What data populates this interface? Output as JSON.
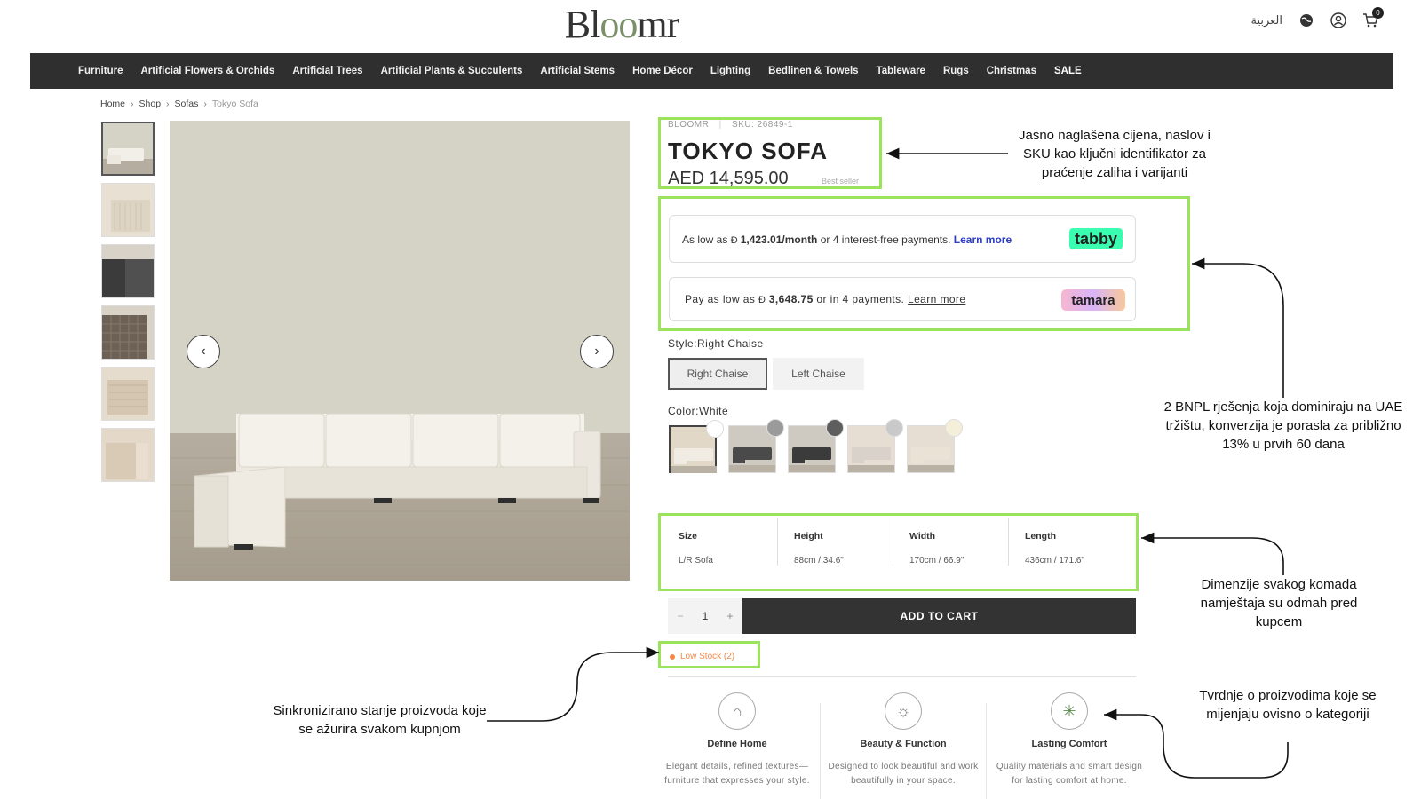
{
  "header": {
    "logo_text_pre": "Bl",
    "logo_text_o": "oo",
    "logo_text_post": "mr",
    "language_label": "العربية",
    "cart_count": "0"
  },
  "nav": {
    "items": [
      "Furniture",
      "Artificial Flowers & Orchids",
      "Artificial Trees",
      "Artificial Plants & Succulents",
      "Artificial Stems",
      "Home Décor",
      "Lighting",
      "Bedlinen & Towels",
      "Tableware",
      "Rugs",
      "Christmas",
      "SALE"
    ]
  },
  "breadcrumb": {
    "items": [
      "Home",
      "Shop",
      "Sofas"
    ],
    "current": "Tokyo Sofa",
    "separator": "›"
  },
  "product": {
    "brand": "BLOOMR",
    "sku": "SKU: 26849-1",
    "title": "TOKYO SOFA",
    "price": "AED 14,595.00",
    "badge": "Best seller"
  },
  "bnpl": {
    "tabby": {
      "text_pre": "As low as ",
      "amount": "1,423.01/month",
      "text_mid": " or 4 interest-free payments. ",
      "link": "Learn more",
      "logo": "tabby"
    },
    "tamara": {
      "text_pre": "Pay as low as ",
      "amount": "3,648.75",
      "text_mid": " or in 4 payments. ",
      "link": "Learn more",
      "logo": "tamara"
    }
  },
  "style_option": {
    "label": "Style:",
    "selected": "Right Chaise",
    "options": [
      "Right Chaise",
      "Left Chaise"
    ]
  },
  "color_option": {
    "label": "Color:",
    "selected": "White",
    "swatches": [
      {
        "name": "white",
        "dot": "#ffffff",
        "bg": "#e2d8c7"
      },
      {
        "name": "dark-grey",
        "dot": "#9a9a9a",
        "bg": "#cfcac1"
      },
      {
        "name": "charcoal",
        "dot": "#5e5e5e",
        "bg": "#cfcac1"
      },
      {
        "name": "light-grey",
        "dot": "#c9c9c9",
        "bg": "#e6ded3"
      },
      {
        "name": "cream",
        "dot": "#f4efd8",
        "bg": "#e6ded3"
      }
    ]
  },
  "dimensions": {
    "headers": [
      "Size",
      "Height",
      "Width",
      "Length"
    ],
    "values": [
      "L/R Sofa",
      "88cm / 34.6\"",
      "170cm / 66.9\"",
      "436cm / 171.6\""
    ]
  },
  "cart": {
    "minus": "−",
    "quantity": "1",
    "plus": "+",
    "button": "ADD TO CART"
  },
  "stock": {
    "label": "Low Stock (2)"
  },
  "features": [
    {
      "icon": "home-circle-icon",
      "glyph": "⌂",
      "title": "Define Home",
      "text": "Elegant details, refined textures—furniture that expresses your style."
    },
    {
      "icon": "sun-icon",
      "glyph": "☼",
      "title": "Beauty & Function",
      "text": "Designed to look beautiful and work beautifully in your space."
    },
    {
      "icon": "asterisk-icon",
      "glyph": "✳",
      "title": "Lasting Comfort",
      "text": "Quality materials and smart design for lasting comfort at home."
    }
  ],
  "annotations": {
    "price_title": "Jasno naglašena cijena, naslov i SKU kao ključni identifikator za praćenje zaliha i varijanti",
    "bnpl": "2 BNPL rješenja  koja dominiraju na UAE tržištu, konverzija je porasla za približno 13% u prvih 60 dana",
    "dimensions": "Dimenzije svakog komada namještaja su odmah pred kupcem",
    "stock": "Sinkronizirano stanje proizvoda koje se ažurira svakom kupnjom",
    "features": "Tvrdnje o proizvodima koje se mijenjaju ovisno o kategoriji"
  },
  "colors": {
    "highlight": "#9be35d",
    "nav_bg": "#2f2f2f",
    "tabby": "#3bffb0",
    "low_stock": "#f08a4b"
  }
}
